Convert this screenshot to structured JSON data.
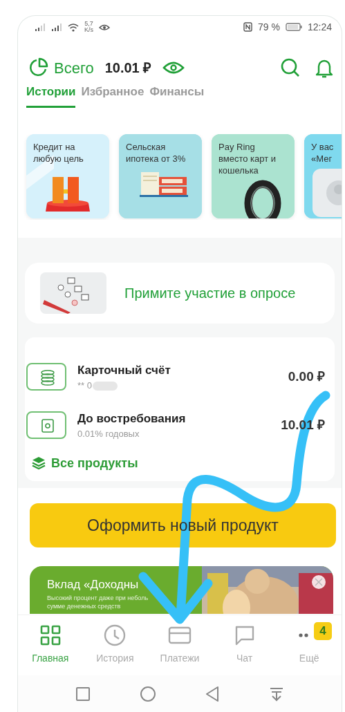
{
  "status_bar": {
    "network_speed": "5,7",
    "speed_unit": "K/s",
    "battery": "79 %",
    "time": "12:24"
  },
  "header": {
    "total_label": "Всего",
    "total_amount": "10.01 ₽"
  },
  "tabs": [
    {
      "label": "Истории",
      "selected": true
    },
    {
      "label": "Избранное",
      "selected": false
    },
    {
      "label": "Финансы",
      "selected": false
    }
  ],
  "stories": [
    {
      "title": "Кредит на\nлюбую цель",
      "kind": "podium"
    },
    {
      "title": "Сельская\nипотека от 3%",
      "kind": "folders"
    },
    {
      "title": "Pay Ring\nвместо карт и\nкошелька",
      "kind": "ring"
    },
    {
      "title": "У вас\n«Мег",
      "kind": "device"
    }
  ],
  "survey": {
    "text": "Примите участие в опросе"
  },
  "accounts": [
    {
      "name": "Карточный счёт",
      "detail": "** 0",
      "masked": true,
      "amount": "0.00 ₽",
      "kind": "card"
    },
    {
      "name": "До востребования",
      "detail": "0.01% годовых",
      "masked": false,
      "amount": "10.01 ₽",
      "kind": "deposit"
    }
  ],
  "all_products": "Все продукты",
  "new_product_button": "Оформить новый продукт",
  "banner": {
    "title": "Вклад «Доходны",
    "lines": [
      "Высокий процент даже при неболь",
      "сумме денежных средств"
    ]
  },
  "bottom_nav": [
    {
      "label": "Главная",
      "selected": true,
      "kind": "home"
    },
    {
      "label": "История",
      "selected": false,
      "kind": "history"
    },
    {
      "label": "Платежи",
      "selected": false,
      "kind": "payments"
    },
    {
      "label": "Чат",
      "selected": false,
      "kind": "chat"
    },
    {
      "label": "Ещё",
      "selected": false,
      "kind": "more",
      "badge": "4"
    }
  ],
  "annotation": {
    "kind": "arrow"
  }
}
